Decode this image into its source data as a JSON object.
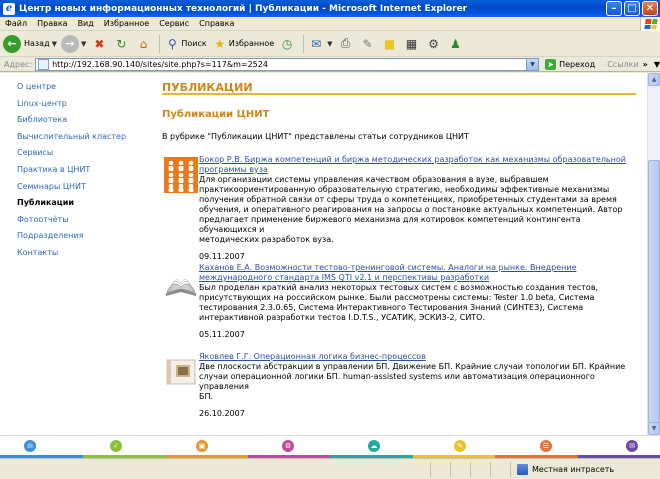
{
  "window": {
    "title": "Центр новых информационных технологий | Публикации - Microsoft Internet Explorer"
  },
  "menu": [
    "Файл",
    "Правка",
    "Вид",
    "Избранное",
    "Сервис",
    "Справка"
  ],
  "toolbar": {
    "back_label": "Назад",
    "search_label": "Поиск",
    "favorites_label": "Избранное"
  },
  "address": {
    "label": "Адрес:",
    "url": "http://192.168.90.140/sites/site.php?s=117&m=2524",
    "go_label": "Переход",
    "links_label": "Ссылки"
  },
  "nav": [
    {
      "label": "О центре",
      "active": false
    },
    {
      "label": "Linux-центр",
      "active": false
    },
    {
      "label": "Библиотека",
      "active": false
    },
    {
      "label": "Вычислительный кластер",
      "active": false
    },
    {
      "label": "Сервисы",
      "active": false
    },
    {
      "label": "Практика в ЦНИТ",
      "active": false
    },
    {
      "label": "Семинары ЦНИТ",
      "active": false
    },
    {
      "label": "Публикации",
      "active": true
    },
    {
      "label": "Фотоотчёты",
      "active": false
    },
    {
      "label": "Подразделения",
      "active": false
    },
    {
      "label": "Контакты",
      "active": false
    }
  ],
  "main": {
    "section": "ПУБЛИКАЦИИ",
    "heading": "Публикации ЦНИТ",
    "intro": "В рубрике \"Публикации ЦНИТ\" представлены статьи сотрудников ЦНИТ"
  },
  "publications": [
    {
      "link_lines": [
        "Бокор Р.В. Биржа компетенций и биржа методических разработок как механизмы образовательной",
        "программы вуза"
      ],
      "desc_lines": [
        "Для организации системы управления качеством образования в вузе, выбравшем",
        "практикоориентированную образовательную стратегию, необходимы эффективные механизмы",
        "получения обратной связи от сферы труда о компетенциях, приобретенных студентами за время",
        "обучения, и оперативного реагирования на запросы о постановке актуальных компетенций. Автор",
        "предлагает применение биржевого механизма для котировок компетенций контингента обучающихся и",
        "методических разработок вуза."
      ],
      "date": "09.11.2007",
      "thumb": "people-grid-icon"
    },
    {
      "link_lines": [
        "Каханов Е.А. Возможности тестово-тренинговой системы. Аналоги на рынке. Внедрение",
        "международного стандарта IMS QTI v2.1 и перспективы разработки"
      ],
      "desc_lines": [
        "Был проделан краткий анализ некоторых тестовых систем с возможностью создания тестов,",
        "присутствующих на российском рынке. Были рассмотрены системы: Tester 1.0 beta, Система",
        "тестирования 2.3.0.65, Система Интерактивного Тестирования Знаний (СИНТЕЗ), Система",
        "интерактивной разработки тестов I.D.T.S., УСАТИК, ЭСКИЗ-2, СИТО."
      ],
      "date": "05.11.2007",
      "thumb": "open-book-icon"
    },
    {
      "link_lines": [
        "Яковлев Г.Г. Операционная логика бизнес-процессов"
      ],
      "desc_lines": [
        "Две плоскости абстракции в управлении БП. Движение БП. Крайние случаи топологии БП. Крайние",
        "случаи операционной логики БП. human-assisted systems или автоматизация операционного управления",
        "БП."
      ],
      "date": "26.10.2007",
      "thumb": "closed-book-icon"
    }
  ],
  "strip_colors": [
    "#3b8fd6",
    "#8cbf3a",
    "#e39a2c",
    "#c04b9c",
    "#2aa6a0",
    "#e8c42a",
    "#e5733a",
    "#6a4aa8"
  ],
  "status": {
    "zone": "Местная интрасеть"
  }
}
